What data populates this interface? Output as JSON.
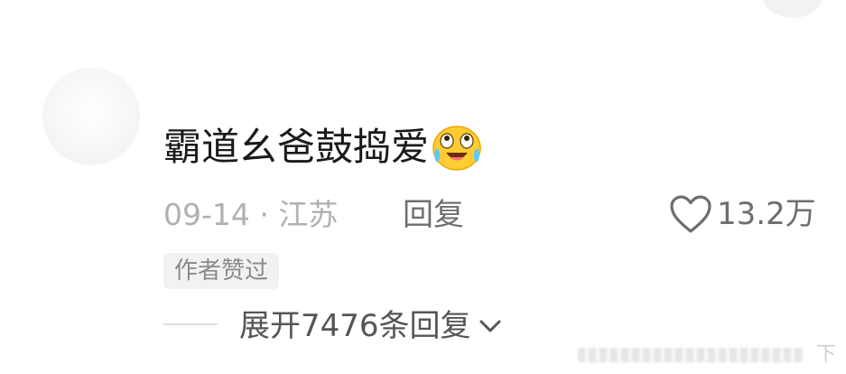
{
  "comment": {
    "username": "",
    "text": "霸道幺爸鼓捣爱",
    "emoji_icon": "crying-laughing-emoji-icon",
    "date": "09-14",
    "separator": "·",
    "location": "江苏",
    "reply_label": "回复",
    "like_count": "13.2万",
    "author_badge": "作者赞过",
    "expand_label": "展开7476条回复"
  },
  "watermark": {
    "text": "下"
  },
  "colors": {
    "text_primary": "#1a1a1a",
    "text_secondary": "#b0b0b0",
    "text_action": "#6e6e6e",
    "badge_bg": "#f2f2f2"
  }
}
